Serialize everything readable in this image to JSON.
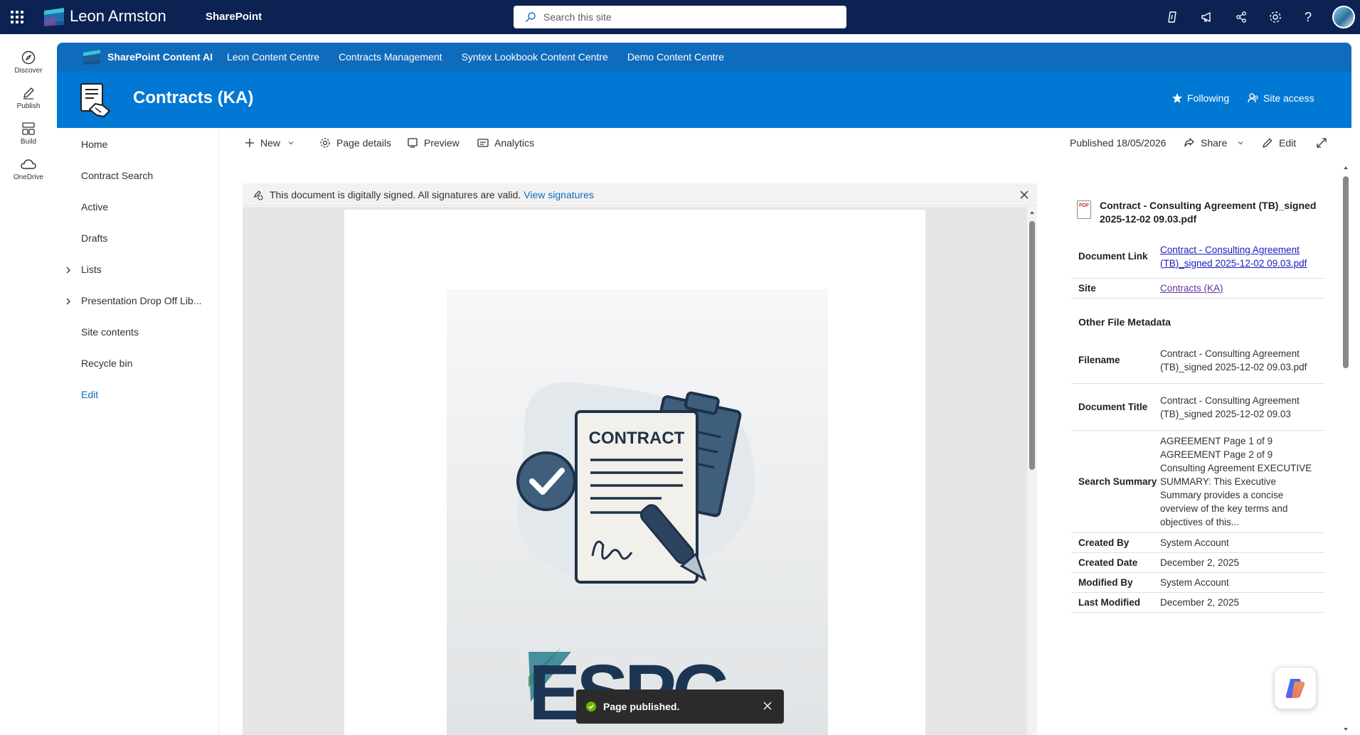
{
  "suitebar": {
    "org_name": "Leon Armston",
    "app_name": "SharePoint",
    "search_placeholder": "Search this site",
    "icons": [
      "copilot-sparkle-icon",
      "megaphone-icon",
      "share-network-icon",
      "gear-icon",
      "help-icon"
    ]
  },
  "appbar": {
    "items": [
      {
        "label": "Discover",
        "icon": "compass-icon"
      },
      {
        "label": "Publish",
        "icon": "pencil-icon"
      },
      {
        "label": "Build",
        "icon": "grid-icon"
      },
      {
        "label": "OneDrive",
        "icon": "cloud-icon"
      }
    ]
  },
  "hub": {
    "title": "SharePoint Content AI",
    "links": [
      "Leon Content Centre",
      "Contracts Management",
      "Syntex Lookbook Content Centre",
      "Demo Content Centre"
    ]
  },
  "site": {
    "title": "Contracts (KA)",
    "following_label": "Following",
    "site_access_label": "Site access"
  },
  "leftnav": {
    "items": [
      "Home",
      "Contract Search",
      "Active",
      "Drafts",
      "Lists",
      "Presentation Drop Off Lib...",
      "Site contents",
      "Recycle bin"
    ],
    "edit_label": "Edit"
  },
  "commandbar": {
    "new_label": "New",
    "page_details_label": "Page details",
    "preview_label": "Preview",
    "analytics_label": "Analytics",
    "published_label": "Published 18/05/2026",
    "share_label": "Share",
    "edit_label": "Edit"
  },
  "viewer": {
    "signature_text": "This document is digitally signed. All signatures are valid.",
    "signature_link": "View signatures",
    "cover_heading": "CONTRACT",
    "cover_brand": "ESPC"
  },
  "toast": {
    "message": "Page published."
  },
  "properties": {
    "file_title": "Contract - Consulting Agreement (TB)_signed 2025-12-02 09.03.pdf",
    "file_badge": "PDF",
    "document_link_label": "Document Link",
    "document_link_value": "Contract - Consulting Agreement (TB)_signed 2025-12-02 09.03.pdf",
    "site_label": "Site",
    "site_value": "Contracts (KA)",
    "other_heading": "Other File Metadata",
    "rows": [
      {
        "key": "Filename",
        "value": "Contract - Consulting Agreement (TB)_signed 2025-12-02 09.03.pdf"
      },
      {
        "key": "Document Title",
        "value": "Contract - Consulting Agreement (TB)_signed 2025-12-02 09.03"
      },
      {
        "key": "Search Summary",
        "value": "AGREEMENT Page 1 of 9 AGREEMENT Page 2 of 9 Consulting Agreement EXECUTIVE SUMMARY: This Executive Summary provides a concise overview of the key terms and objectives of this..."
      },
      {
        "key": "Created By",
        "value": "System Account"
      },
      {
        "key": "Created Date",
        "value": "December 2, 2025"
      },
      {
        "key": "Modified By",
        "value": "System Account"
      },
      {
        "key": "Last Modified",
        "value": "December 2, 2025"
      }
    ]
  },
  "colors": {
    "suitebar": "#0c2253",
    "hubnav": "#0f6cbd",
    "siteheader": "#0078d4",
    "link": "#0f6cbd",
    "toast": "#2b2b2b",
    "success": "#6bb700"
  }
}
